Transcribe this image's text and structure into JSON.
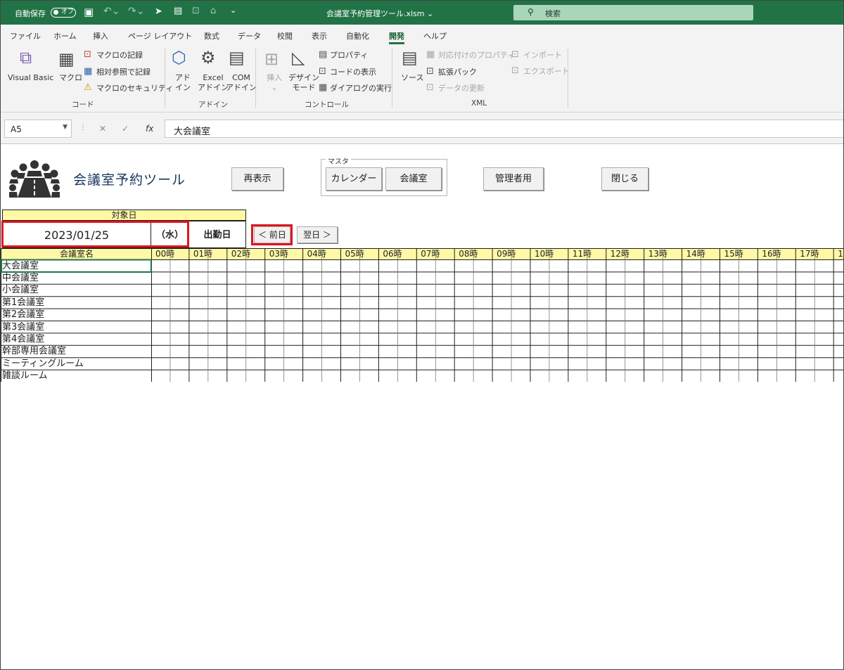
{
  "titlebar": {
    "autosave": "自動保存",
    "autosave_state": "オフ",
    "filename": "会議室予約管理ツール.xlsm",
    "search": "検索"
  },
  "tabs": [
    "ファイル",
    "ホーム",
    "挿入",
    "ページ レイアウト",
    "数式",
    "データ",
    "校閲",
    "表示",
    "自動化",
    "開発",
    "ヘルプ"
  ],
  "active_tab": "開発",
  "ribbon": {
    "code": {
      "visual_basic": "Visual Basic",
      "macro": "マクロ",
      "record_macro": "マクロの記録",
      "relative_ref": "相対参照で記録",
      "macro_security": "マクロのセキュリティ",
      "group": "コード"
    },
    "addin": {
      "addin_l1": "アド",
      "addin_l2": "イン",
      "excel_l1": "Excel",
      "excel_l2": "アドイン",
      "com_l1": "COM",
      "com_l2": "アドイン",
      "group": "アドイン"
    },
    "control": {
      "insert": "挿入",
      "design_l1": "デザイン",
      "design_l2": "モード",
      "properties": "プロパティ",
      "view_code": "コードの表示",
      "run_dialog": "ダイアログの実行",
      "group": "コントロール"
    },
    "xml": {
      "source": "ソース",
      "map_properties": "対応付けのプロパティ",
      "expansion_packs": "拡張パック",
      "refresh_data": "データの更新",
      "import": "インポート",
      "export": "エクスポート",
      "group": "XML"
    }
  },
  "formula_bar": {
    "name_box": "A5",
    "formula": "大会議室"
  },
  "sheet": {
    "app_title": "会議室予約ツール",
    "buttons": {
      "refresh": "再表示",
      "master_label": "マスタ",
      "calendar": "カレンダー",
      "rooms": "会議室",
      "admin": "管理者用",
      "close": "閉じる",
      "prev_day": "＜ 前日",
      "next_day": "翌日 ＞"
    },
    "target_date_label": "対象日",
    "date": "2023/01/25",
    "weekday": "（水）",
    "day_type": "出勤日",
    "room_header": "会議室名",
    "hours": [
      "00時",
      "01時",
      "02時",
      "03時",
      "04時",
      "05時",
      "06時",
      "07時",
      "08時",
      "09時",
      "10時",
      "11時",
      "12時",
      "13時",
      "14時",
      "15時",
      "16時",
      "17時",
      "1"
    ],
    "rooms": [
      "大会議室",
      "中会議室",
      "小会議室",
      "第1会議室",
      "第2会議室",
      "第3会議室",
      "第4会議室",
      "幹部専用会議室",
      "ミーティングルーム",
      "雑談ルーム"
    ]
  }
}
